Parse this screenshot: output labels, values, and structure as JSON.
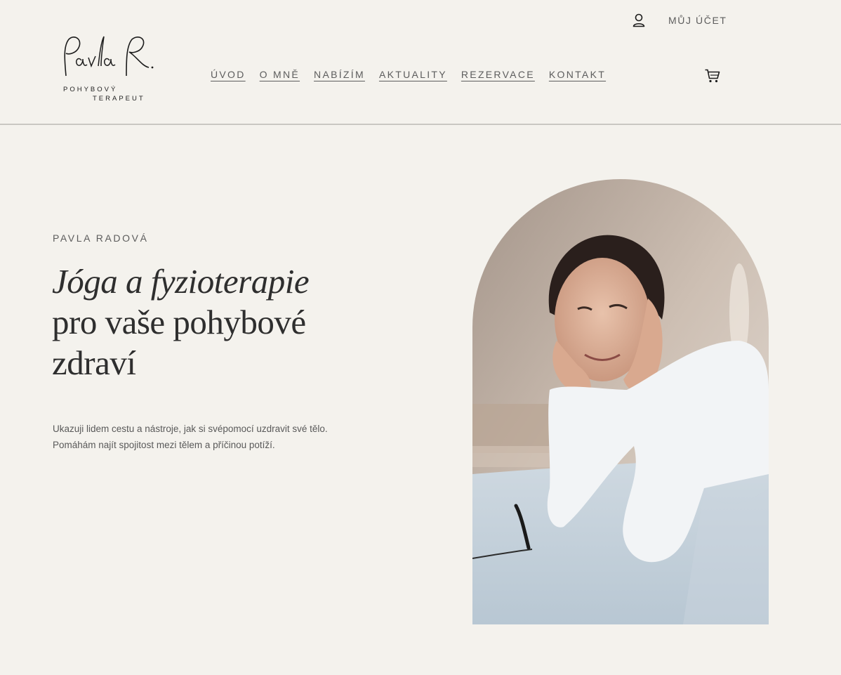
{
  "header": {
    "logo": {
      "script_text": "PavlaR.",
      "line1": "POHYBOVÝ",
      "line2": "TERAPEUT"
    },
    "nav": [
      {
        "label": "ÚVOD"
      },
      {
        "label": "O MNĚ"
      },
      {
        "label": "NABÍZÍM"
      },
      {
        "label": "AKTUALITY"
      },
      {
        "label": "REZERVACE"
      },
      {
        "label": "KONTAKT"
      }
    ],
    "account_label": "MŮJ ÚČET",
    "account_icon": "user-icon",
    "cart_icon": "cart-icon"
  },
  "hero": {
    "eyebrow": "PAVLA RADOVÁ",
    "headline_italic": "Jóga a fyzioterapie",
    "headline_rest": "pro vaše pohybové zdraví",
    "description_line1": "Ukazuji lidem cestu a nástroje, jak si svépomocí uzdravit své tělo.",
    "description_line2": "Pomáhám najít spojitost mezi tělem a příčinou potíží."
  },
  "colors": {
    "background": "#f4f2ed",
    "text": "#2e2e2e",
    "muted": "#5d5d5d",
    "divider": "#c9c7c2"
  }
}
